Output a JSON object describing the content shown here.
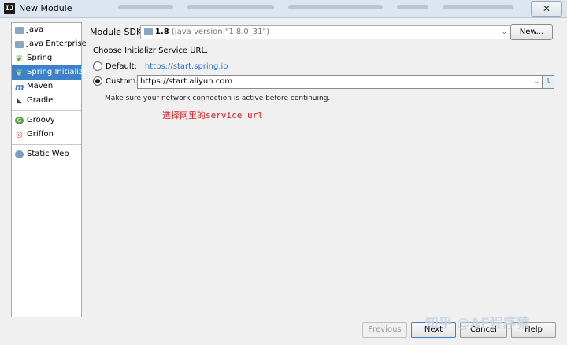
{
  "window": {
    "title": "New Module",
    "app_icon_text": "IJ",
    "close_glyph": "✕"
  },
  "sidebar": {
    "items": [
      {
        "label": "Java",
        "icon": "folder-icon"
      },
      {
        "label": "Java Enterprise",
        "icon": "folder-icon"
      },
      {
        "label": "Spring",
        "icon": "leaf-icon"
      },
      {
        "label": "Spring Initializr",
        "icon": "spring-initializr-icon",
        "selected": true
      },
      {
        "label": "Maven",
        "icon": "maven-icon"
      },
      {
        "label": "Gradle",
        "icon": "gradle-icon"
      },
      {
        "label": "Groovy",
        "icon": "groovy-icon"
      },
      {
        "label": "Griffon",
        "icon": "griffon-icon"
      },
      {
        "label": "Static Web",
        "icon": "web-icon"
      }
    ]
  },
  "sdk": {
    "label": "Module SDK:",
    "value": "1.8",
    "detail": "(java version \"1.8.0_31\")",
    "new_button": "New..."
  },
  "initializr": {
    "heading": "Choose Initializr Service URL.",
    "default_label": "Default:",
    "default_url": "https://start.spring.io",
    "custom_label": "Custom:",
    "custom_url": "https://start.aliyun.com",
    "note": "Make sure your network connection is active before continuing.",
    "annotation": "选择网里的service url"
  },
  "footer": {
    "previous": "Previous",
    "next": "Next",
    "cancel": "Cancel",
    "help": "Help"
  },
  "watermark": "知乎 @AF程序猿",
  "colors": {
    "selection": "#3d82c9",
    "link": "#2a6fc9",
    "annotation": "#d02020"
  }
}
